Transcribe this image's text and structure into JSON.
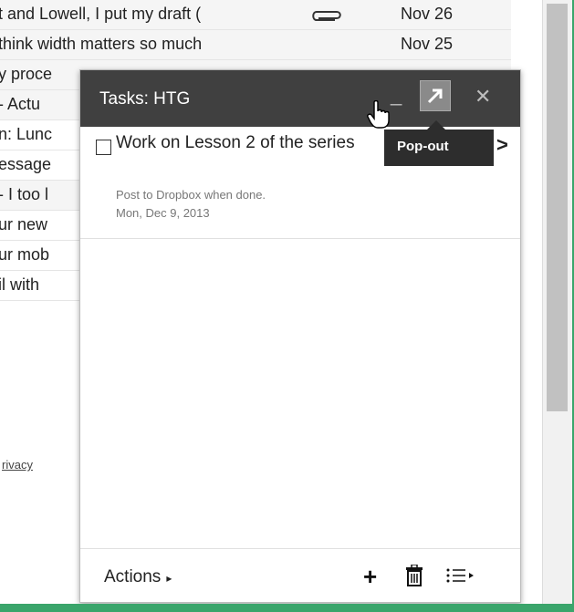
{
  "emails": [
    {
      "subject": "t and Lowell, I put my draft (",
      "attachment": true,
      "date": "Nov 26",
      "unread": false
    },
    {
      "subject": "think width matters so much",
      "attachment": false,
      "date": "Nov 25",
      "unread": false
    },
    {
      "subject": "y proce",
      "attachment": false,
      "date": "",
      "unread": false
    },
    {
      "subject": "- Actu",
      "attachment": false,
      "date": "",
      "unread": false
    },
    {
      "subject": "n: Lunc",
      "attachment": false,
      "date": "",
      "unread": true
    },
    {
      "subject": "essage",
      "attachment": false,
      "date": "",
      "unread": true
    },
    {
      "subject": "- I too l",
      "attachment": false,
      "date": "",
      "unread": false
    },
    {
      "subject": "ur new",
      "attachment": false,
      "date": "",
      "unread": true
    },
    {
      "subject": "ur mob",
      "attachment": false,
      "date": "",
      "unread": true
    },
    {
      "subject": "il with",
      "attachment": false,
      "date": "",
      "unread": true
    }
  ],
  "privacy_link": "rivacy",
  "tasks": {
    "title": "Tasks: HTG",
    "minimize_label": "_",
    "close_label": "✕",
    "tooltip": "Pop-out",
    "item": {
      "title": "Work on Lesson 2 of the series",
      "note": "Post to Dropbox when done.",
      "date": "Mon, Dec 9, 2013",
      "arrow": ">"
    },
    "footer": {
      "actions_label": "Actions",
      "actions_arrow": "▸",
      "add_label": "+"
    }
  },
  "colors": {
    "header_bg": "#404040",
    "tooltip_bg": "#2d2d2d",
    "window_border": "#3aa56b"
  }
}
